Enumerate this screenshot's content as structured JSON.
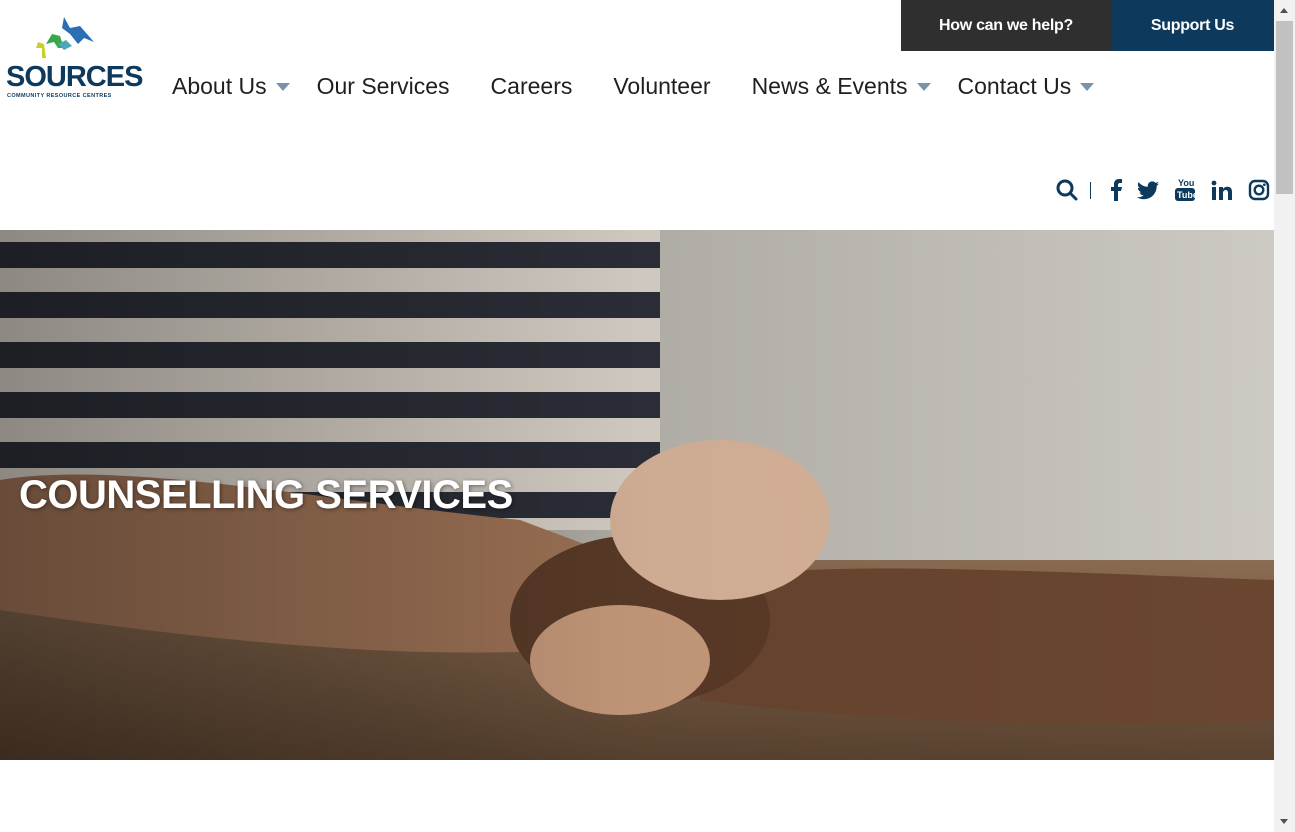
{
  "utility": {
    "help_label": "How can we help?",
    "support_label": "Support Us"
  },
  "logo": {
    "wordmark": "SOURCES",
    "tagline": "COMMUNITY RESOURCE CENTRES"
  },
  "nav": {
    "items": [
      {
        "label": "About Us",
        "has_dropdown": true
      },
      {
        "label": "Our Services",
        "has_dropdown": false
      },
      {
        "label": "Careers",
        "has_dropdown": false
      },
      {
        "label": "Volunteer",
        "has_dropdown": false
      },
      {
        "label": "News & Events",
        "has_dropdown": true
      },
      {
        "label": "Contact Us",
        "has_dropdown": true
      }
    ]
  },
  "social": {
    "icons": [
      "search-icon",
      "facebook-icon",
      "twitter-icon",
      "youtube-icon",
      "linkedin-icon",
      "instagram-icon"
    ]
  },
  "hero": {
    "title": "COUNSELLING SERVICES"
  },
  "colors": {
    "brand_navy": "#0d3a5c",
    "dark_bar": "#2f2f2f",
    "caret": "#7a93ab"
  }
}
